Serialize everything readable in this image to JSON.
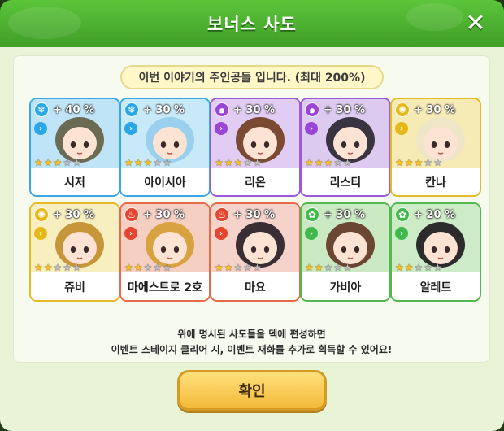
{
  "dialog": {
    "title": "보너스 사도",
    "close_icon": "✕",
    "subtitle": "이번 이야기의 주인공들 입니다. (최대 200%)",
    "footer_line1": "위에 명시된 사도들을 덱에 편성하면",
    "footer_line2": "이벤트 스테이지 클리어 시, 이벤트 재화를 추가로 획득할 수 있어요!",
    "confirm_label": "확인"
  },
  "element_colors": {
    "ice": "#2aa7e8",
    "void": "#9b45d6",
    "light": "#e5b81a",
    "fire": "#e4452e",
    "nature": "#3fb94a"
  },
  "characters": [
    {
      "name": "시저",
      "bonus": "+ 40 %",
      "element": "ice",
      "element_icon": "snowflake-icon",
      "stars": 3,
      "max_stars": 5,
      "border": "#3aa6e6",
      "bg": "#bfe4f7"
    },
    {
      "name": "아이시아",
      "bonus": "+ 30 %",
      "element": "ice",
      "element_icon": "snowflake-icon",
      "stars": 3,
      "max_stars": 5,
      "border": "#3aa6e6",
      "bg": "#c7e9f8"
    },
    {
      "name": "리온",
      "bonus": "+ 30 %",
      "element": "void",
      "element_icon": "swirl-icon",
      "stars": 3,
      "max_stars": 5,
      "border": "#9d5ad8",
      "bg": "#e1ccf3"
    },
    {
      "name": "리스티",
      "bonus": "+ 30 %",
      "element": "void",
      "element_icon": "swirl-icon",
      "stars": 3,
      "max_stars": 5,
      "border": "#9d5ad8",
      "bg": "#dccaf0"
    },
    {
      "name": "칸나",
      "bonus": "+ 30 %",
      "element": "light",
      "element_icon": "sun-icon",
      "stars": 3,
      "max_stars": 5,
      "border": "#e3bb2a",
      "bg": "#f6ebb5"
    },
    {
      "name": "쥬비",
      "bonus": "+ 30 %",
      "element": "light",
      "element_icon": "sun-icon",
      "stars": 2,
      "max_stars": 5,
      "border": "#e3bb2a",
      "bg": "#f7efc0"
    },
    {
      "name": "마에스트로 2호",
      "bonus": "+ 30 %",
      "element": "fire",
      "element_icon": "flame-icon",
      "stars": 2,
      "max_stars": 5,
      "border": "#e76a4b",
      "bg": "#f6cfc3"
    },
    {
      "name": "마요",
      "bonus": "+ 30 %",
      "element": "fire",
      "element_icon": "flame-icon",
      "stars": 2,
      "max_stars": 5,
      "border": "#e76a4b",
      "bg": "#f5d3ca"
    },
    {
      "name": "가비아",
      "bonus": "+ 30 %",
      "element": "nature",
      "element_icon": "leaf-icon",
      "stars": 2,
      "max_stars": 5,
      "border": "#53b84d",
      "bg": "#cbeac4"
    },
    {
      "name": "알레트",
      "bonus": "+ 20 %",
      "element": "nature",
      "element_icon": "leaf-icon",
      "stars": 2,
      "max_stars": 5,
      "border": "#53b84d",
      "bg": "#cdebc7"
    }
  ]
}
